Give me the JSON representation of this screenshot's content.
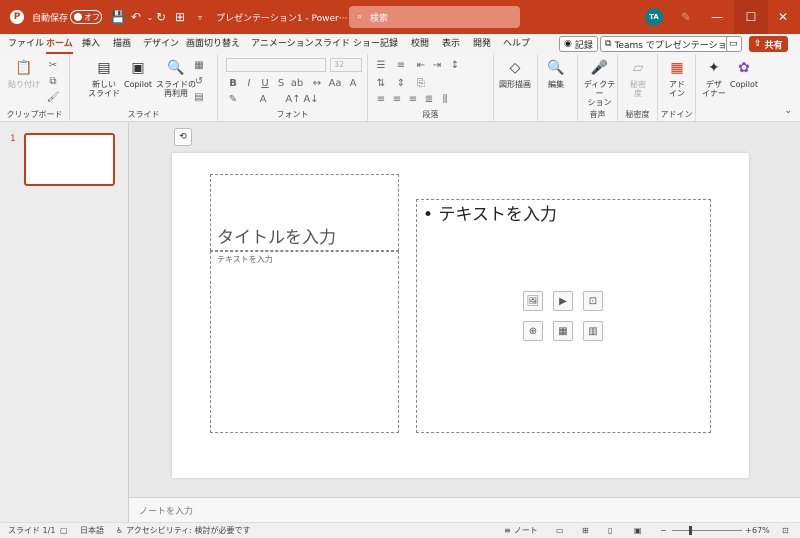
{
  "titlebar": {
    "autosave_label": "自動保存",
    "autosave_state": "オフ",
    "doc_title": "プレゼンテーション1 - Power···",
    "search_placeholder": "検索",
    "avatar_initials": "TA",
    "accent_color": "#c43e1c"
  },
  "menu": {
    "tabs": [
      "ファイル",
      "ホーム",
      "挿入",
      "描画",
      "デザイン",
      "画面切り替え",
      "アニメーション",
      "スライド ショー",
      "記録",
      "校閲",
      "表示",
      "開発",
      "ヘルプ"
    ],
    "active_tab": "ホーム",
    "record_label": "記録",
    "teams_label": "Teams でプレゼンテーション",
    "share_label": "共有"
  },
  "ribbon": {
    "clipboard": {
      "paste": "貼り付け",
      "group": "クリップボード"
    },
    "slides": {
      "new_slide_line1": "新しい",
      "new_slide_line2": "スライド",
      "copilot": "Copilot",
      "reuse_line1": "スライドの",
      "reuse_line2": "再利用",
      "group": "スライド"
    },
    "font": {
      "font_name": "",
      "font_size": "32",
      "group": "フォント"
    },
    "paragraph": {
      "group": "段落"
    },
    "drawing": {
      "shapes": "図形描画"
    },
    "editing": {
      "label": "編集"
    },
    "voice": {
      "dictate": "ディクテー",
      "dictate2": "ション",
      "group": "音声"
    },
    "sensitivity": {
      "label_line1": "秘密",
      "label_line2": "度",
      "group": "秘密度"
    },
    "addins": {
      "label_line1": "アド",
      "label_line2": "イン",
      "group": "アドイン"
    },
    "designer": {
      "label_line1": "デザ",
      "label_line2": "イナー"
    },
    "copilot": {
      "label": "Copilot"
    }
  },
  "thumbnails": {
    "slide_number": "1"
  },
  "slide": {
    "title_placeholder": "タイトルを入力",
    "text_placeholder": "テキストを入力",
    "content_placeholder": "• テキストを入力"
  },
  "notes": {
    "placeholder": "ノートを入力"
  },
  "status": {
    "slide_counter": "スライド 1/1",
    "language": "日本語",
    "accessibility": "アクセシビリティ: 検討が必要です",
    "notes_button": "ノート",
    "zoom_level": "67%",
    "zoom_fraction": 0.25
  }
}
